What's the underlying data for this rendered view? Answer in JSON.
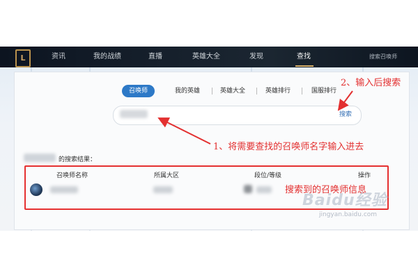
{
  "app": {
    "logo_text": "L"
  },
  "nav": {
    "items": [
      "资讯",
      "我的战绩",
      "直播",
      "英雄大全",
      "发现",
      "查找",
      "搜索召唤师"
    ],
    "active": "查找"
  },
  "tabs": [
    "召唤师",
    "我的英雄",
    "英雄大全",
    "英雄排行",
    "国服排行"
  ],
  "active_tab": "召唤师",
  "search": {
    "value": "",
    "placeholder": "",
    "button_label": "搜索"
  },
  "results": {
    "heading": "的搜索结果：",
    "columns": [
      "召唤师名称",
      "所属大区",
      "段位/等级",
      "操作"
    ]
  },
  "annotations": {
    "step1": "1、将需要查找的召唤师名字输入进去",
    "step2": "2、输入后搜索",
    "result_label": "搜索到的召唤师信息"
  },
  "watermark": {
    "brand": "Baidu经验",
    "url": "jingyan.baidu.com"
  },
  "colors": {
    "accent": "#2d79c7",
    "annotation": "#e33030",
    "topbar": "#16202c"
  }
}
